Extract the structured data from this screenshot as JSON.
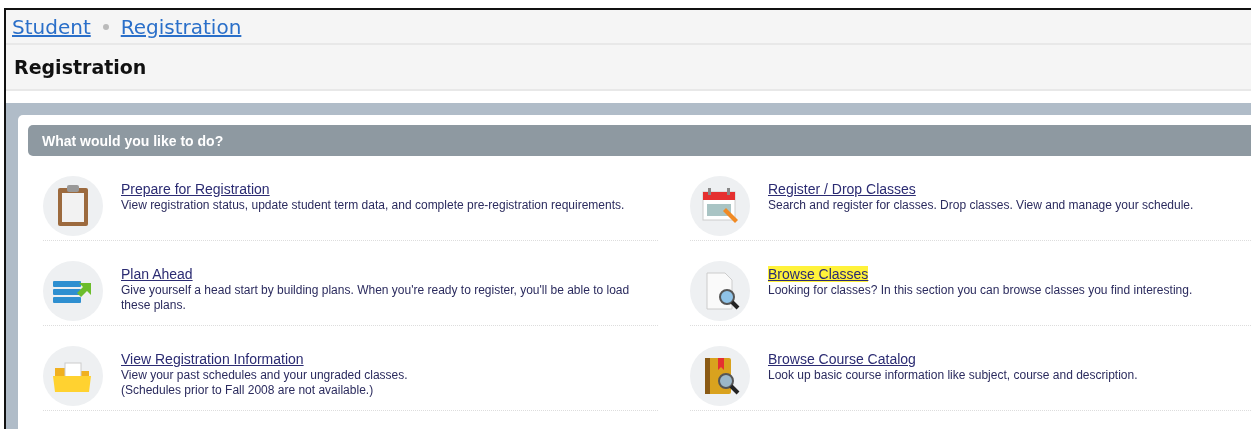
{
  "breadcrumbs": [
    {
      "label": "Student"
    },
    {
      "label": "Registration"
    }
  ],
  "page_title": "Registration",
  "panel": {
    "heading": "What would you like to do?",
    "actions": [
      {
        "kind": "clipboard",
        "title": "Prepare for Registration",
        "description": "View registration status, update student term data, and complete pre-registration requirements.",
        "highlighted": false
      },
      {
        "kind": "calendar",
        "title": "Register / Drop Classes",
        "description": "Search and register for classes. Drop classes. View and manage your schedule.",
        "highlighted": false
      },
      {
        "kind": "plan",
        "title": "Plan Ahead",
        "description": "Give yourself a head start by building plans. When you're ready to register, you'll be able to load these plans.",
        "highlighted": false
      },
      {
        "kind": "document-search",
        "title": "Browse Classes",
        "description": "Looking for classes? In this section you can browse classes you find interesting.",
        "highlighted": true
      },
      {
        "kind": "folder",
        "title": "View Registration Information",
        "description": "View your past schedules and your ungraded classes.",
        "note": "(Schedules prior to Fall 2008 are not available.)",
        "highlighted": false
      },
      {
        "kind": "book-search",
        "title": "Browse Course Catalog",
        "description": "Look up basic course information like subject, course and description.",
        "highlighted": false
      }
    ]
  }
}
